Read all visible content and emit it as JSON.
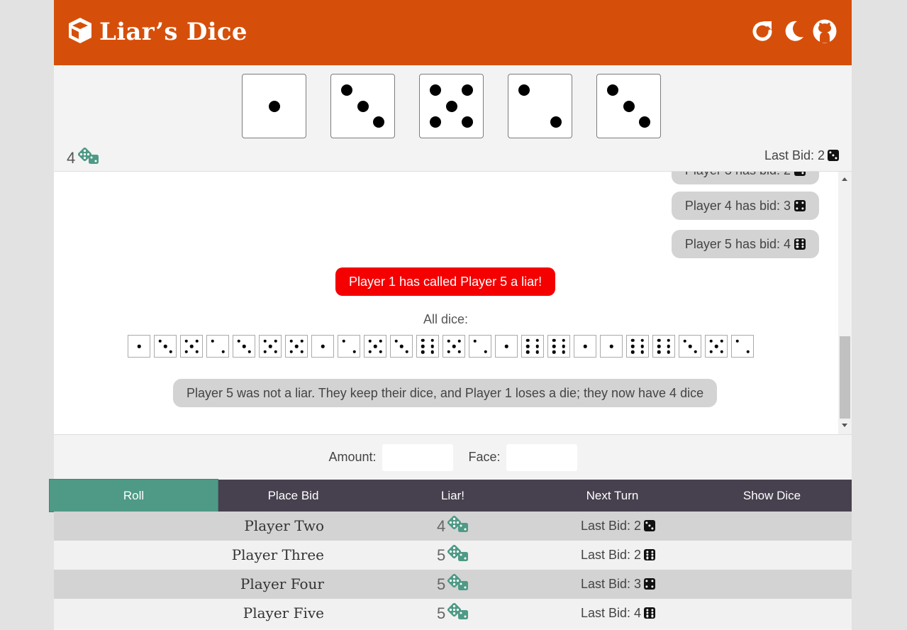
{
  "app": {
    "title": "Liar’s Dice"
  },
  "header": {
    "icons": [
      "cube-icon",
      "refresh-icon",
      "moon-icon",
      "github-icon"
    ]
  },
  "hand": {
    "dice": [
      1,
      3,
      5,
      2,
      3
    ],
    "dice_count": "4",
    "last_bid_label": "Last Bid: 2",
    "last_bid_face": 3
  },
  "log": {
    "bids": [
      {
        "text": "Player 3 has bid: 2",
        "face": 3
      },
      {
        "text": "Player 4 has bid: 3",
        "face": 4
      },
      {
        "text": "Player 5 has bid: 4",
        "face": 6
      }
    ],
    "call": "Player 1 has called Player 5 a liar!",
    "all_dice_label": "All dice:",
    "all_dice": [
      1,
      3,
      5,
      2,
      3,
      5,
      5,
      1,
      2,
      5,
      3,
      6,
      5,
      2,
      1,
      6,
      6,
      1,
      1,
      6,
      6,
      3,
      5,
      2
    ],
    "result": "Player 5 was not a liar. They keep their dice, and Player 1 loses a die; they now have 4 dice"
  },
  "bid_form": {
    "amount_label": "Amount:",
    "amount_value": "",
    "face_label": "Face:",
    "face_value": ""
  },
  "actions": {
    "roll": "Roll",
    "place_bid": "Place Bid",
    "liar": "Liar!",
    "next_turn": "Next Turn",
    "show_dice": "Show Dice"
  },
  "players": [
    {
      "name": "Player Two",
      "dice": "4",
      "last_bid": "Last Bid: 2",
      "face": 3
    },
    {
      "name": "Player Three",
      "dice": "5",
      "last_bid": "Last Bid: 2",
      "face": 6
    },
    {
      "name": "Player Four",
      "dice": "5",
      "last_bid": "Last Bid: 3",
      "face": 4
    },
    {
      "name": "Player Five",
      "dice": "5",
      "last_bid": "Last Bid: 4",
      "face": 6
    }
  ],
  "colors": {
    "header": "#d64f0a",
    "accent": "#4e9a86",
    "action_bar": "#47414f",
    "liar_call": "#f40000"
  }
}
